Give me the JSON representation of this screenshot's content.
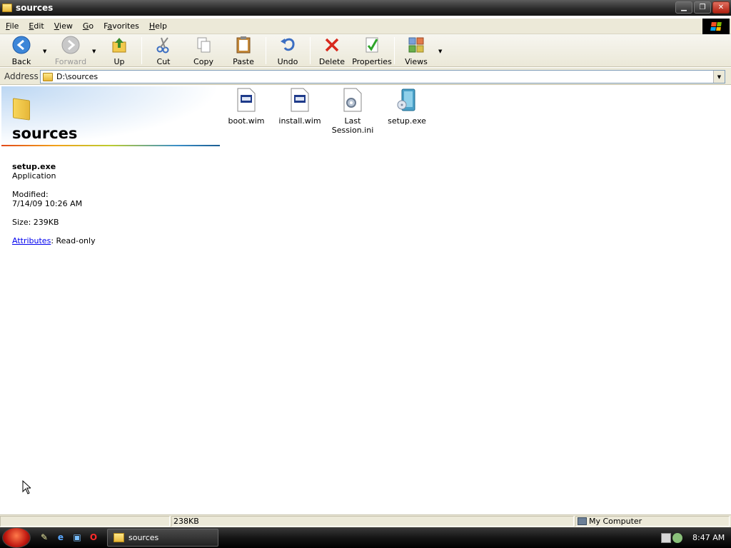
{
  "window": {
    "title": "sources",
    "minimize_glyph": "▁",
    "maximize_glyph": "❐",
    "close_glyph": "✕"
  },
  "menu": [
    {
      "u": "F",
      "rest": "ile"
    },
    {
      "u": "E",
      "rest": "dit"
    },
    {
      "u": "V",
      "rest": "iew"
    },
    {
      "u": "G",
      "rest": "o"
    },
    {
      "pre": "F",
      "u": "a",
      "rest": "vorites"
    },
    {
      "u": "H",
      "rest": "elp"
    }
  ],
  "toolbar": {
    "back": "Back",
    "forward": "Forward",
    "up": "Up",
    "cut": "Cut",
    "copy": "Copy",
    "paste": "Paste",
    "undo": "Undo",
    "delete": "Delete",
    "properties": "Properties",
    "views": "Views"
  },
  "address": {
    "label": "Address",
    "value": "D:\\sources"
  },
  "folder_pane": {
    "title": "sources",
    "selected_name": "setup.exe",
    "selected_type": "Application",
    "modified_label": "Modified:",
    "modified_value": "7/14/09 10:26 AM",
    "size_text": "Size: 239KB",
    "attributes_link": "Attributes",
    "attributes_value": ": Read-only"
  },
  "files": [
    {
      "name": "boot.wim",
      "icon": "wim-file-icon"
    },
    {
      "name": "install.wim",
      "icon": "wim-file-icon"
    },
    {
      "name": "Last\nSession.ini",
      "icon": "ini-settings-icon"
    },
    {
      "name": "setup.exe",
      "icon": "setup-exe-icon"
    }
  ],
  "status": {
    "size": "238KB",
    "zone": "My Computer"
  },
  "taskbar": {
    "task_label": "sources",
    "clock": "8:47 AM"
  },
  "colors": {
    "link": "#0000ee",
    "titlebar": "#2b2b2b",
    "chrome": "#ece9d8"
  }
}
